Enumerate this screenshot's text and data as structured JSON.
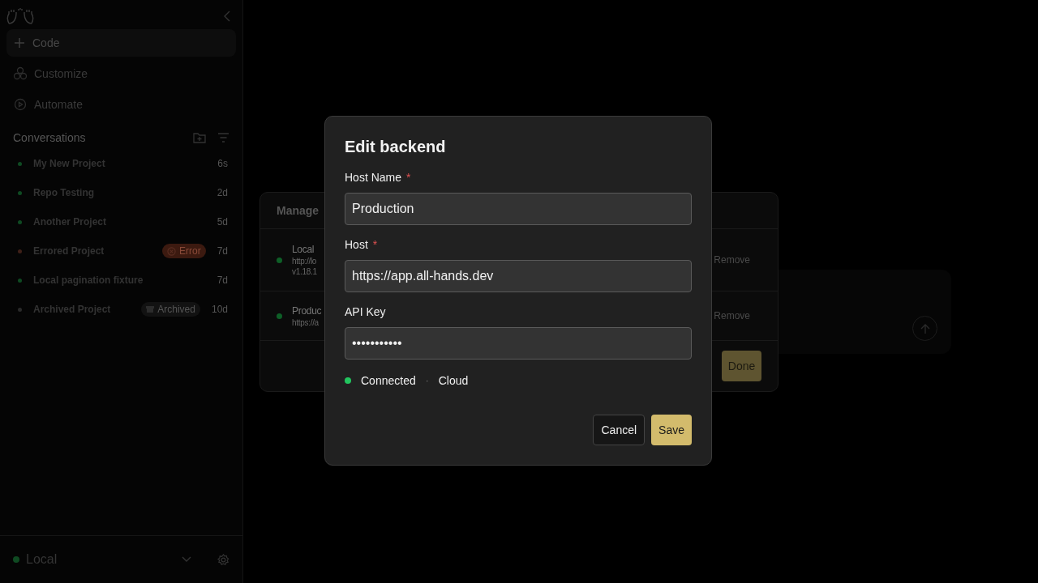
{
  "sidebar": {
    "nav": [
      {
        "kind": "new",
        "label": "Code",
        "selected": true
      },
      {
        "kind": "customize",
        "label": "Customize",
        "selected": false
      },
      {
        "kind": "automate",
        "label": "Automate",
        "selected": false
      }
    ],
    "conversations_title": "Conversations",
    "conversations": [
      {
        "title": "My New Project",
        "time": "6s",
        "color": "#0f4a22"
      },
      {
        "title": "Repo Testing",
        "time": "2d",
        "color": "#0f4a22"
      },
      {
        "title": "Another Project",
        "time": "5d",
        "color": "#0f4a22"
      },
      {
        "title": "Errored Project",
        "time": "7d",
        "color": "#3f2018",
        "badge": {
          "kind": "error",
          "label": "Error"
        }
      },
      {
        "title": "Local pagination fixture",
        "time": "7d",
        "color": "#0f4a22"
      },
      {
        "title": "Archived Project",
        "time": "10d",
        "color": "#2a2a2a",
        "badge": {
          "kind": "archived",
          "label": "Archived"
        }
      }
    ],
    "backend": {
      "label": "Local",
      "color": "#0f4a22"
    }
  },
  "manage_dialog": {
    "title": "Manage",
    "backends": [
      {
        "name": "Local",
        "lines": [
          "http://lo",
          "v1.18.1"
        ],
        "color": "#0e5f27",
        "action": "Remove"
      },
      {
        "name": "Produc",
        "lines": [
          "https://a"
        ],
        "color": "#0e5f27",
        "action": "Remove"
      }
    ],
    "done": "Done"
  },
  "edit_dialog": {
    "title": "Edit backend",
    "fields": [
      {
        "label": "Host Name",
        "required_mark": "*",
        "value": "Production"
      },
      {
        "label": "Host",
        "required_mark": "*",
        "value": "https://app.all-hands.dev"
      },
      {
        "label": "API Key",
        "value": "•••••••••••"
      }
    ],
    "status": {
      "label": "Connected",
      "separator": "·",
      "type": "Cloud",
      "color": "#22c55e"
    },
    "cancel": "Cancel",
    "save": "Save"
  }
}
